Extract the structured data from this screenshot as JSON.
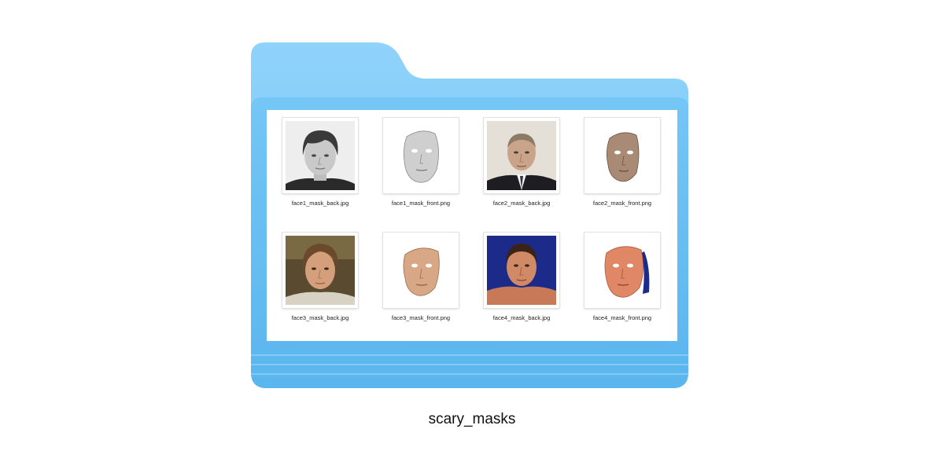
{
  "folder": {
    "name": "scary_masks",
    "color": "#7cc8f5"
  },
  "files": [
    {
      "name": "face1_mask_back.jpg"
    },
    {
      "name": "face1_mask_front.png"
    },
    {
      "name": "face2_mask_back.jpg"
    },
    {
      "name": "face2_mask_front.png"
    },
    {
      "name": "face3_mask_back.jpg"
    },
    {
      "name": "face3_mask_front.png"
    },
    {
      "name": "face4_mask_back.jpg"
    },
    {
      "name": "face4_mask_front.png"
    }
  ]
}
